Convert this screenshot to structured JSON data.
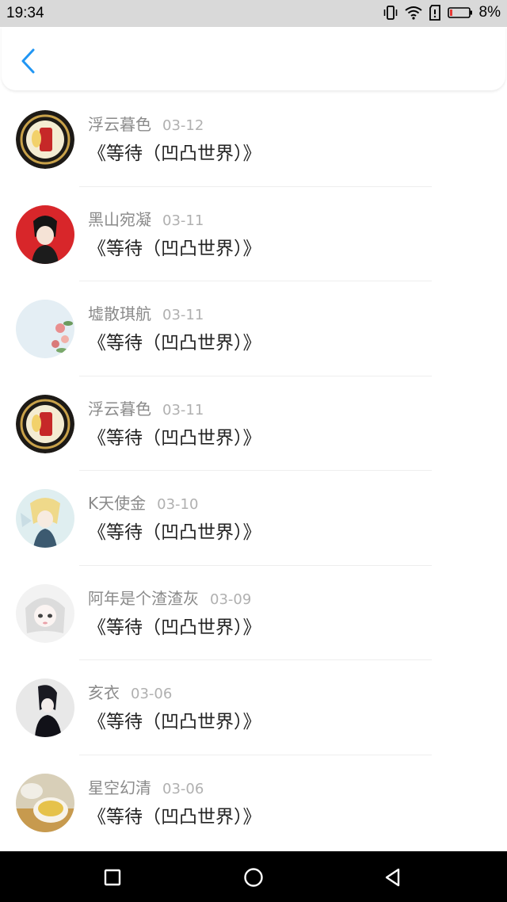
{
  "status_bar": {
    "time": "19:34",
    "battery": "8%",
    "icons": [
      "vibrate-icon",
      "wifi-icon",
      "sim-alert-icon",
      "battery-icon"
    ]
  },
  "app_bar": {
    "back_icon": "chevron-left-icon",
    "accent": "#2196f3"
  },
  "items": [
    {
      "author": "浮云暮色",
      "date": "03-12",
      "title": "《等待（凹凸世界）》",
      "avatar": "fu-character-avatar"
    },
    {
      "author": "黑山宛凝",
      "date": "03-11",
      "title": "《等待（凹凸世界）》",
      "avatar": "anime-boy-red-avatar"
    },
    {
      "author": "墟散琪航",
      "date": "03-11",
      "title": "《等待（凹凸世界）》",
      "avatar": "flower-avatar"
    },
    {
      "author": "浮云暮色",
      "date": "03-11",
      "title": "《等待（凹凸世界）》",
      "avatar": "fu-character-avatar"
    },
    {
      "author": "K天使金",
      "date": "03-10",
      "title": "《等待（凹凸世界）》",
      "avatar": "angel-girl-avatar"
    },
    {
      "author": "阿年是个渣渣灰",
      "date": "03-09",
      "title": "《等待（凹凸世界）》",
      "avatar": "white-hair-girl-avatar"
    },
    {
      "author": "亥衣",
      "date": "03-06",
      "title": "《等待（凹凸世界）》",
      "avatar": "dark-figure-avatar"
    },
    {
      "author": "星空幻清",
      "date": "03-06",
      "title": "《等待（凹凸世界）》",
      "avatar": "tea-cup-avatar"
    }
  ],
  "nav_bar": {
    "buttons": [
      "recents-square-icon",
      "home-circle-icon",
      "back-triangle-icon"
    ]
  }
}
